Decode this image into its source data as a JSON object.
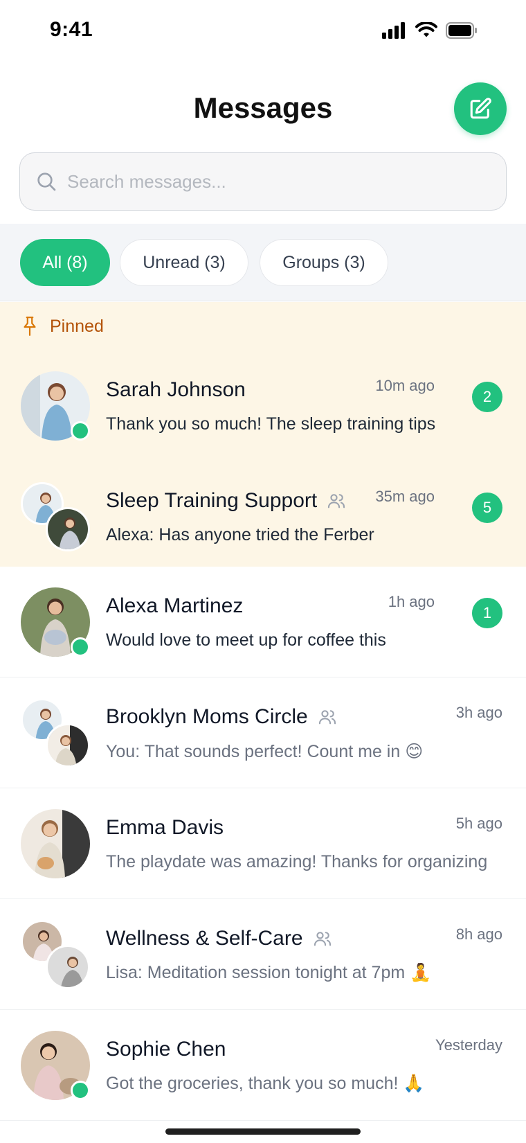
{
  "status_bar": {
    "time": "9:41"
  },
  "header": {
    "title": "Messages"
  },
  "search": {
    "placeholder": "Search messages..."
  },
  "filters": [
    {
      "label": "All (8)",
      "active": true
    },
    {
      "label": "Unread (3)",
      "active": false
    },
    {
      "label": "Groups (3)",
      "active": false
    }
  ],
  "pinned": {
    "label": "Pinned"
  },
  "conversations": [
    {
      "name": "Sarah Johnson",
      "time": "10m ago",
      "message": "Thank you so much! The sleep training tips",
      "unread": "2",
      "online": true,
      "group": false
    },
    {
      "name": "Sleep Training Support",
      "time": "35m ago",
      "message": "Alexa: Has anyone tried the Ferber",
      "unread": "5",
      "online": false,
      "group": true
    },
    {
      "name": "Alexa Martinez",
      "time": "1h ago",
      "message": "Would love to meet up for coffee this",
      "unread": "1",
      "online": true,
      "group": false
    },
    {
      "name": "Brooklyn Moms Circle",
      "time": "3h ago",
      "message": "You: That sounds perfect! Count me in 😊",
      "online": false,
      "group": true
    },
    {
      "name": "Emma Davis",
      "time": "5h ago",
      "message": "The playdate was amazing! Thanks for organizing",
      "online": false,
      "group": false
    },
    {
      "name": "Wellness & Self-Care",
      "time": "8h ago",
      "message": "Lisa: Meditation session tonight at 7pm 🧘",
      "online": false,
      "group": true
    },
    {
      "name": "Sophie Chen",
      "time": "Yesterday",
      "message": "Got the groceries, thank you so much! 🙏",
      "online": true,
      "group": false
    }
  ],
  "colors": {
    "accent": "#22c17f",
    "pinned_bg": "#fdf6e6",
    "pinned_text": "#b45309",
    "filter_bg": "#f3f5f8"
  },
  "icons": [
    "signal-icon",
    "wifi-icon",
    "battery-icon",
    "compose-icon",
    "search-icon",
    "pin-icon",
    "group-icon"
  ]
}
